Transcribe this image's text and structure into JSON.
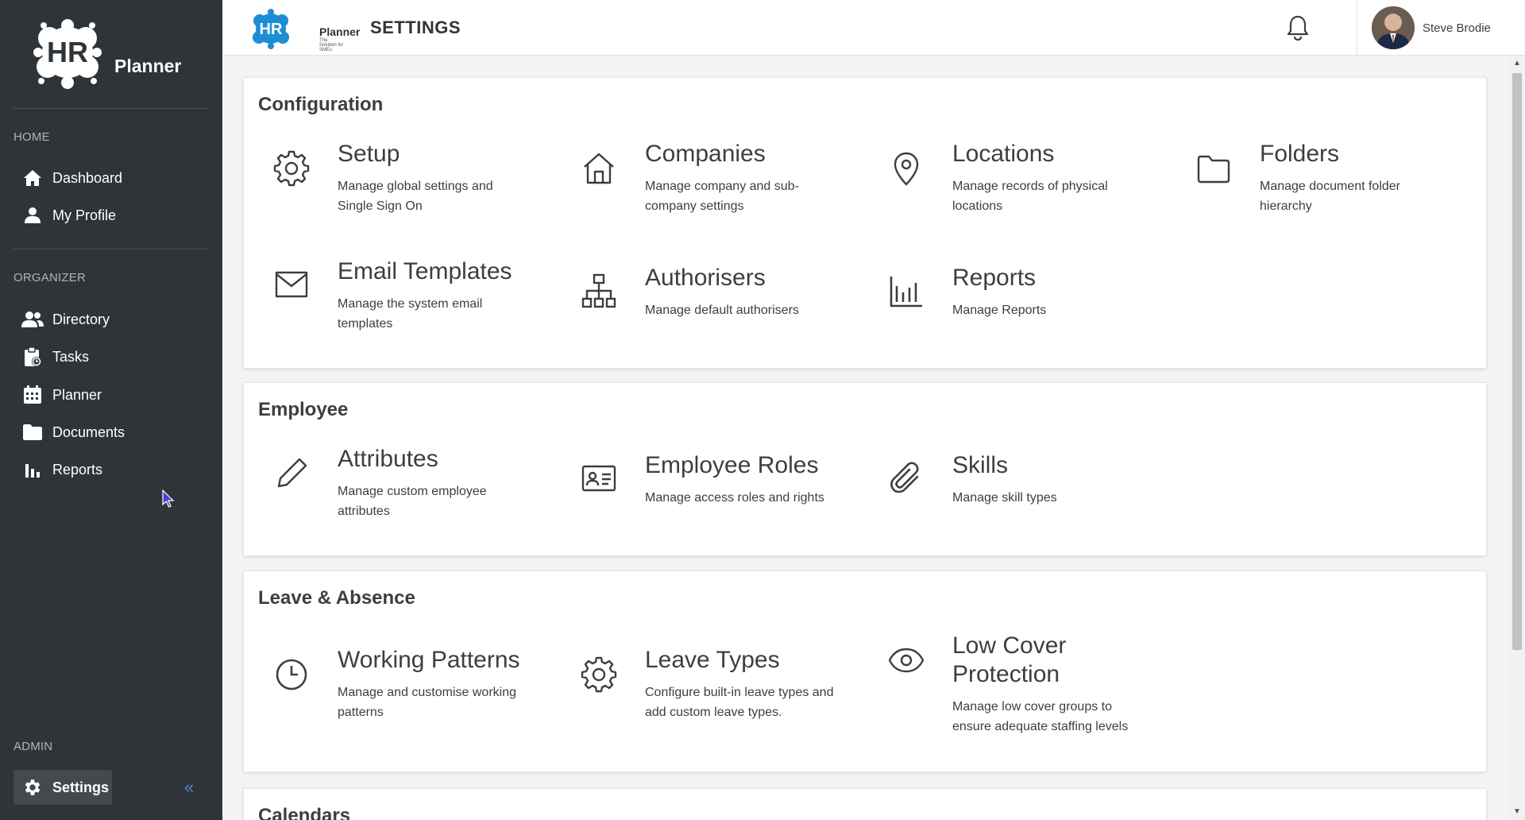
{
  "brand": {
    "logo_letters": "HR",
    "name": "Planner",
    "tagline": "The Solution for SMEs"
  },
  "page_title": "SETTINGS",
  "user": {
    "name": "Steve Brodie"
  },
  "sidebar": {
    "home_label": "HOME",
    "home_items": [
      {
        "label": "Dashboard",
        "icon": "home-icon"
      },
      {
        "label": "My Profile",
        "icon": "user-icon"
      }
    ],
    "organizer_label": "ORGANIZER",
    "organizer_items": [
      {
        "label": "Directory",
        "icon": "users-icon"
      },
      {
        "label": "Tasks",
        "icon": "clipboard-icon"
      },
      {
        "label": "Planner",
        "icon": "calendar-icon"
      },
      {
        "label": "Documents",
        "icon": "folder-icon"
      },
      {
        "label": "Reports",
        "icon": "bar-chart-icon"
      }
    ],
    "admin_label": "ADMIN",
    "admin_items": [
      {
        "label": "Settings",
        "icon": "gear-icon",
        "active": true
      }
    ],
    "collapse_glyph": "«"
  },
  "sections": {
    "configuration": {
      "title": "Configuration",
      "tiles": [
        {
          "name": "Setup",
          "desc": "Manage global settings and Single Sign On",
          "icon": "gear-icon"
        },
        {
          "name": "Companies",
          "desc": "Manage company and sub-company settings",
          "icon": "house-icon"
        },
        {
          "name": "Locations",
          "desc": "Manage records of physical locations",
          "icon": "map-pin-icon"
        },
        {
          "name": "Folders",
          "desc": "Manage document folder hierarchy",
          "icon": "folder-icon"
        },
        {
          "name": "Email Templates",
          "desc": "Manage the system email templates",
          "icon": "envelope-icon"
        },
        {
          "name": "Authorisers",
          "desc": "Manage default authorisers",
          "icon": "org-chart-icon"
        },
        {
          "name": "Reports",
          "desc": "Manage Reports",
          "icon": "bar-chart-icon"
        }
      ]
    },
    "employee": {
      "title": "Employee",
      "tiles": [
        {
          "name": "Attributes",
          "desc": "Manage custom employee attributes",
          "icon": "pencil-icon"
        },
        {
          "name": "Employee Roles",
          "desc": "Manage access roles and rights",
          "icon": "id-card-icon"
        },
        {
          "name": "Skills",
          "desc": "Manage skill types",
          "icon": "paperclip-icon"
        }
      ]
    },
    "leave": {
      "title": "Leave & Absence",
      "tiles": [
        {
          "name": "Working Patterns",
          "desc": "Manage and customise working patterns",
          "icon": "clock-icon"
        },
        {
          "name": "Leave Types",
          "desc": "Configure built-in leave types and add custom leave types.",
          "icon": "gear-icon"
        },
        {
          "name": "Low Cover Protection",
          "desc": "Manage low cover groups to ensure adequate staffing levels",
          "icon": "eye-icon"
        }
      ]
    },
    "calendars": {
      "title": "Calendars"
    }
  },
  "colors": {
    "sidebar_bg": "#2f3438",
    "accent": "#5b7fd6",
    "text": "#3a3f44"
  }
}
